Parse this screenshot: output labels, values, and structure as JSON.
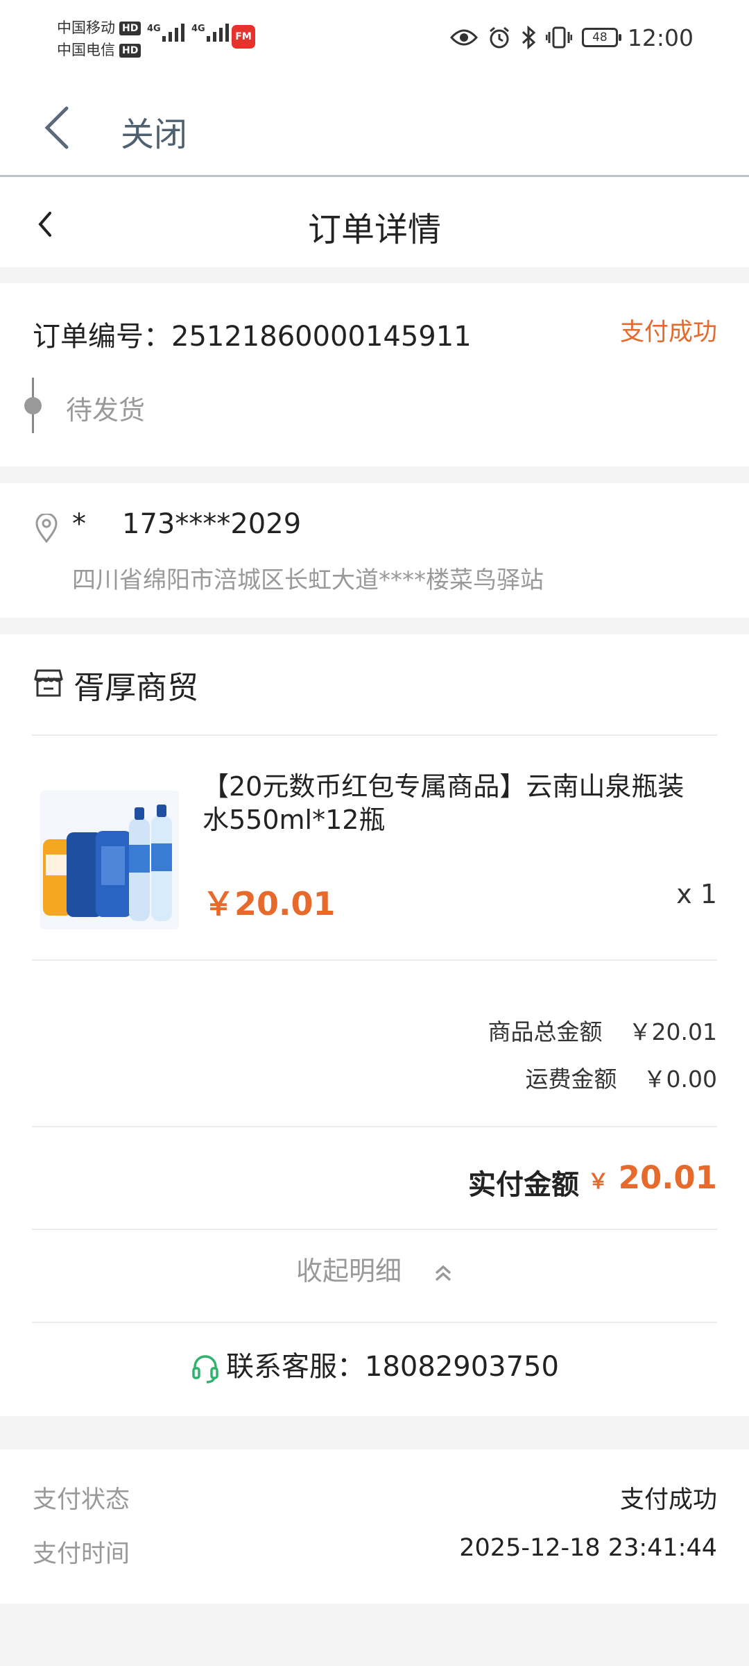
{
  "status_bar": {
    "carrier1": "中国移动",
    "carrier2": "中国电信",
    "hd": "HD",
    "net1": "4G",
    "net2": "4G",
    "fm_badge": "FM",
    "battery": "48",
    "time": "12:00",
    "icons": [
      "eye-icon",
      "alarm-icon",
      "bluetooth-icon",
      "vibrate-icon",
      "battery-icon"
    ]
  },
  "close_bar": {
    "close_label": "关闭"
  },
  "header": {
    "title": "订单详情"
  },
  "order": {
    "number_label": "订单编号：",
    "number": "2512186000014591 1",
    "status": "支付成功",
    "progress": "待发货"
  },
  "address": {
    "name": "*",
    "phone": "173****2029",
    "line": "四川省绵阳市涪城区长虹大道****楼菜鸟驿站"
  },
  "store": {
    "name": "胥厚商贸"
  },
  "product": {
    "title": "【20元数币红包专属商品】云南山泉瓶装水550ml*12瓶",
    "price": "￥20.01",
    "qty": "x 1"
  },
  "summary": {
    "goods_total_label": "商品总金额",
    "goods_total": "￥20.01",
    "shipping_label": "运费金额",
    "shipping": "￥0.00",
    "paid_label": "实付金额",
    "paid_currency": "￥",
    "paid_amount": "20.01",
    "collapse_label": "收起明细",
    "service_label": "联系客服：",
    "service_phone": "18082903750"
  },
  "payment": {
    "status_label": "支付状态",
    "status_value": "支付成功",
    "time_label": "支付时间",
    "time_value": "2025-12-18 23:41:44"
  },
  "colors": {
    "accent": "#e56a2c",
    "service_icon": "#2db36b"
  }
}
